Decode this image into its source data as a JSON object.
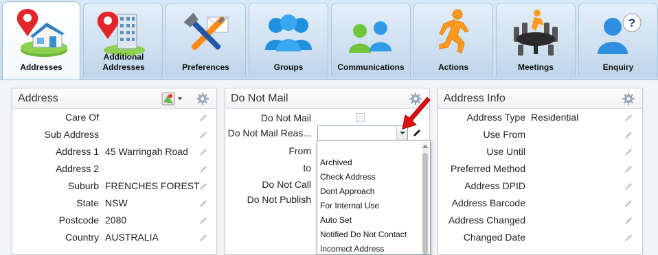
{
  "tabs": [
    {
      "label": "Addresses",
      "icon": "house-pin-icon",
      "active": true
    },
    {
      "label": "Additional Addresses",
      "icon": "building-pin-icon",
      "active": false
    },
    {
      "label": "Preferences",
      "icon": "tools-icon",
      "active": false
    },
    {
      "label": "Groups",
      "icon": "group-icon",
      "active": false
    },
    {
      "label": "Communications",
      "icon": "communications-icon",
      "active": false
    },
    {
      "label": "Actions",
      "icon": "running-man-icon",
      "active": false
    },
    {
      "label": "Meetings",
      "icon": "meeting-table-icon",
      "active": false
    },
    {
      "label": "Enquiry",
      "icon": "enquiry-person-icon",
      "active": false
    }
  ],
  "address_panel": {
    "title": "Address",
    "fields": [
      {
        "label": "Care Of",
        "value": ""
      },
      {
        "label": "Sub Address",
        "value": ""
      },
      {
        "label": "Address 1",
        "value": "45 Warringah Road"
      },
      {
        "label": "Address 2",
        "value": ""
      },
      {
        "label": "Suburb",
        "value": "FRENCHES FOREST"
      },
      {
        "label": "State",
        "value": "NSW"
      },
      {
        "label": "Postcode",
        "value": "2080"
      },
      {
        "label": "Country",
        "value": "AUSTRALIA"
      }
    ]
  },
  "do_not_mail_panel": {
    "title": "Do Not Mail",
    "do_not_mail_label": "Do Not Mail",
    "reason_label": "Do Not Mail Reas...",
    "reason_value": "",
    "from_label": "From",
    "to_label": "to",
    "do_not_call_label": "Do Not Call",
    "do_not_publish_label": "Do Not Publish",
    "reason_options": [
      "",
      "Archived",
      "Check Address",
      "Dont Approach",
      "For Internal Use",
      "Auto Set",
      "Notified Do Not Contact",
      "Incorrect Address"
    ]
  },
  "address_info_panel": {
    "title": "Address Info",
    "fields": [
      {
        "label": "Address Type",
        "value": "Residential"
      },
      {
        "label": "Use From",
        "value": ""
      },
      {
        "label": "Use Until",
        "value": ""
      },
      {
        "label": "Preferred Method",
        "value": ""
      },
      {
        "label": "Address DPID",
        "value": ""
      },
      {
        "label": "Address Barcode",
        "value": ""
      },
      {
        "label": "Address Changed",
        "value": ""
      },
      {
        "label": "Changed Date",
        "value": ""
      }
    ]
  },
  "colors": {
    "accent": "#5a9bd5",
    "annotation_arrow": "#e01010",
    "tab_bg": "#cfe0f0"
  }
}
